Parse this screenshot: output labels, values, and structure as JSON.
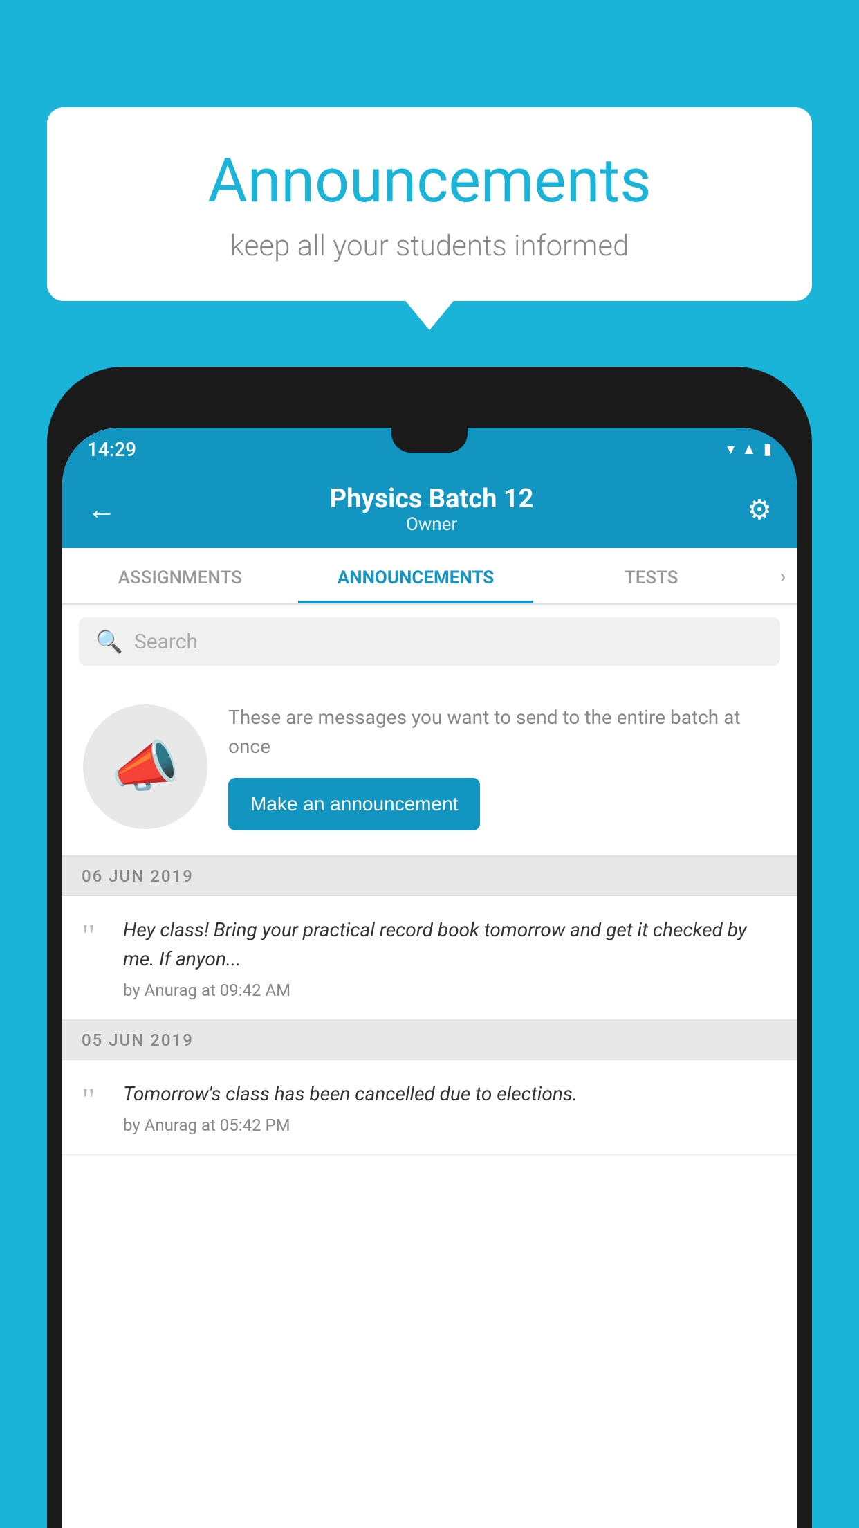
{
  "background_color": "#1ab4d8",
  "speech_bubble": {
    "title": "Announcements",
    "subtitle": "keep all your students informed"
  },
  "phone": {
    "status_bar": {
      "time": "14:29",
      "icons": [
        "wifi",
        "signal",
        "battery"
      ]
    },
    "header": {
      "title": "Physics Batch 12",
      "subtitle": "Owner",
      "back_label": "←",
      "settings_label": "⚙"
    },
    "tabs": [
      {
        "label": "ASSIGNMENTS",
        "active": false
      },
      {
        "label": "ANNOUNCEMENTS",
        "active": true
      },
      {
        "label": "TESTS",
        "active": false
      }
    ],
    "search": {
      "placeholder": "Search"
    },
    "promo": {
      "description": "These are messages you want to send to the entire batch at once",
      "button_label": "Make an announcement"
    },
    "announcements": [
      {
        "date": "06  JUN  2019",
        "message": "Hey class! Bring your practical record book tomorrow and get it checked by me. If anyon...",
        "meta": "by Anurag at 09:42 AM"
      },
      {
        "date": "05  JUN  2019",
        "message": "Tomorrow's class has been cancelled due to elections.",
        "meta": "by Anurag at 05:42 PM"
      }
    ]
  }
}
